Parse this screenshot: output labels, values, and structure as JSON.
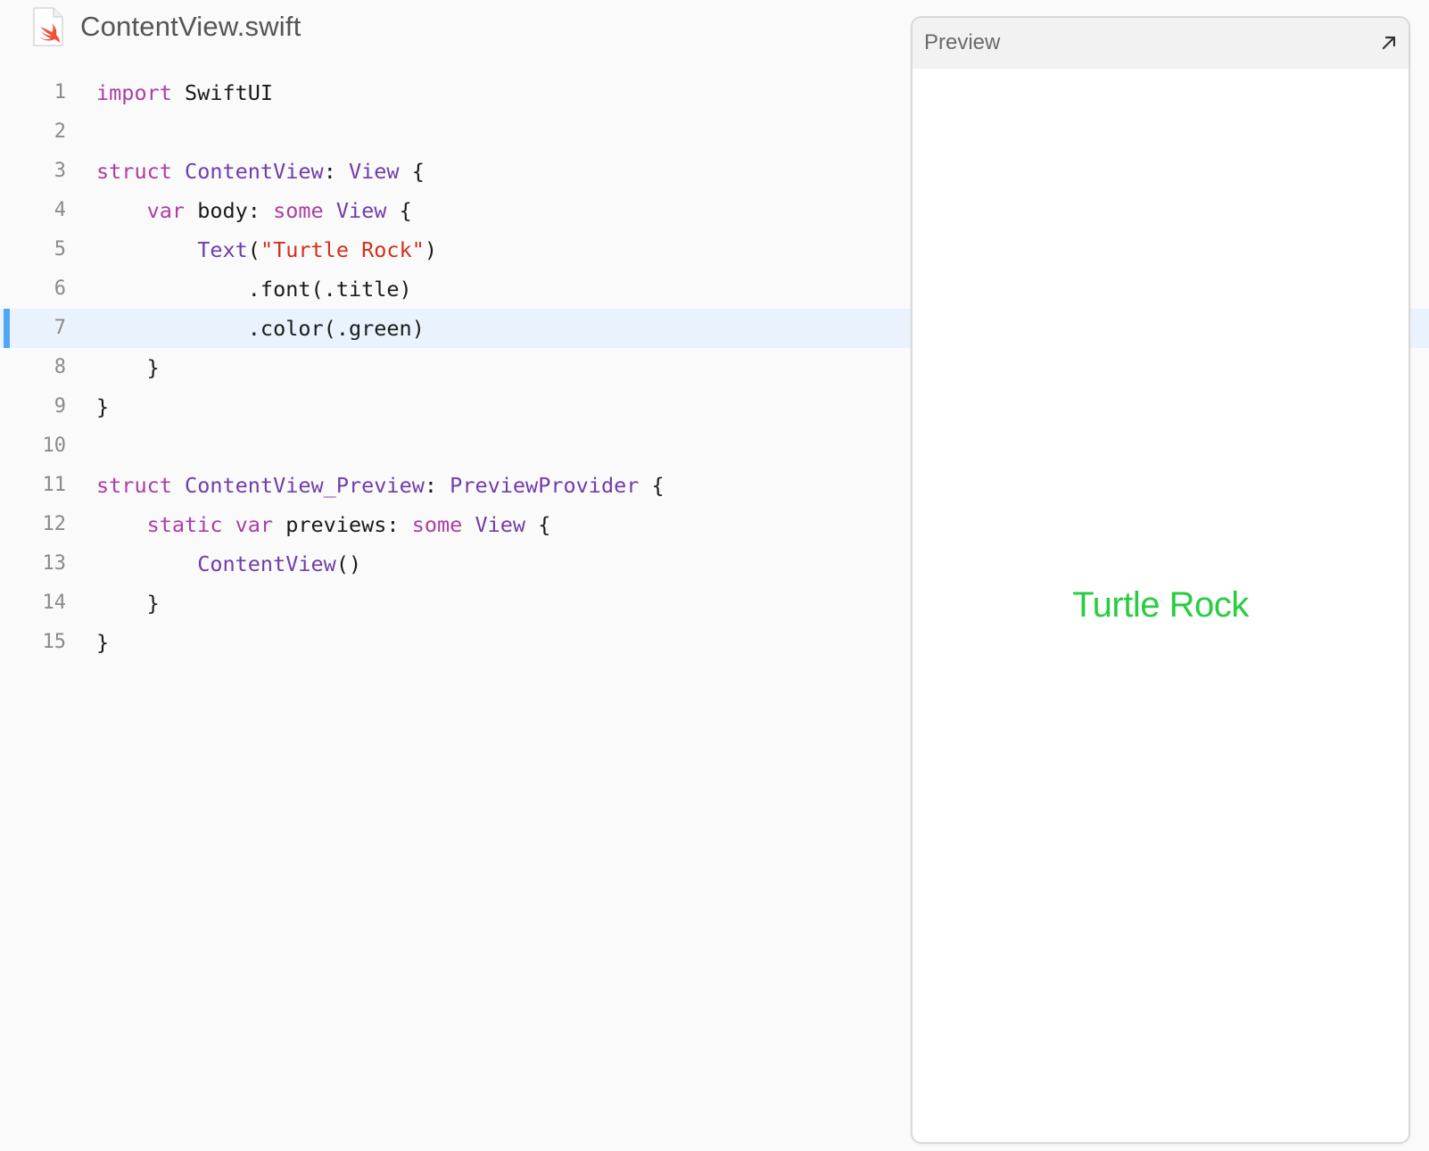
{
  "file": {
    "name": "ContentView.swift",
    "icon": "swift-file-icon"
  },
  "editor": {
    "highlighted_line": 7,
    "lines": [
      {
        "number": "1",
        "tokens": [
          {
            "t": "import",
            "c": "kw"
          },
          {
            "t": " SwiftUI",
            "c": "pl"
          }
        ]
      },
      {
        "number": "2",
        "tokens": []
      },
      {
        "number": "3",
        "tokens": [
          {
            "t": "struct",
            "c": "kw"
          },
          {
            "t": " ",
            "c": "pl"
          },
          {
            "t": "ContentView",
            "c": "ty"
          },
          {
            "t": ": ",
            "c": "pl"
          },
          {
            "t": "View",
            "c": "ty"
          },
          {
            "t": " {",
            "c": "pl"
          }
        ]
      },
      {
        "number": "4",
        "tokens": [
          {
            "t": "    ",
            "c": "pl"
          },
          {
            "t": "var",
            "c": "kw"
          },
          {
            "t": " body: ",
            "c": "pl"
          },
          {
            "t": "some",
            "c": "kw"
          },
          {
            "t": " ",
            "c": "pl"
          },
          {
            "t": "View",
            "c": "ty"
          },
          {
            "t": " {",
            "c": "pl"
          }
        ]
      },
      {
        "number": "5",
        "tokens": [
          {
            "t": "        ",
            "c": "pl"
          },
          {
            "t": "Text",
            "c": "ty"
          },
          {
            "t": "(",
            "c": "pl"
          },
          {
            "t": "\"Turtle Rock\"",
            "c": "str"
          },
          {
            "t": ")",
            "c": "pl"
          }
        ]
      },
      {
        "number": "6",
        "tokens": [
          {
            "t": "            .font(.title)",
            "c": "pl"
          }
        ]
      },
      {
        "number": "7",
        "tokens": [
          {
            "t": "            .color(.green)",
            "c": "pl"
          }
        ]
      },
      {
        "number": "8",
        "tokens": [
          {
            "t": "    }",
            "c": "pl"
          }
        ]
      },
      {
        "number": "9",
        "tokens": [
          {
            "t": "}",
            "c": "pl"
          }
        ]
      },
      {
        "number": "10",
        "tokens": []
      },
      {
        "number": "11",
        "tokens": [
          {
            "t": "struct",
            "c": "kw"
          },
          {
            "t": " ",
            "c": "pl"
          },
          {
            "t": "ContentView_Preview",
            "c": "ty"
          },
          {
            "t": ": ",
            "c": "pl"
          },
          {
            "t": "PreviewProvider",
            "c": "ty"
          },
          {
            "t": " {",
            "c": "pl"
          }
        ]
      },
      {
        "number": "12",
        "tokens": [
          {
            "t": "    ",
            "c": "pl"
          },
          {
            "t": "static",
            "c": "kw"
          },
          {
            "t": " ",
            "c": "pl"
          },
          {
            "t": "var",
            "c": "kw"
          },
          {
            "t": " previews: ",
            "c": "pl"
          },
          {
            "t": "some",
            "c": "kw"
          },
          {
            "t": " ",
            "c": "pl"
          },
          {
            "t": "View",
            "c": "ty"
          },
          {
            "t": " {",
            "c": "pl"
          }
        ]
      },
      {
        "number": "13",
        "tokens": [
          {
            "t": "        ",
            "c": "pl"
          },
          {
            "t": "ContentView",
            "c": "ty"
          },
          {
            "t": "()",
            "c": "pl"
          }
        ]
      },
      {
        "number": "14",
        "tokens": [
          {
            "t": "    }",
            "c": "pl"
          }
        ]
      },
      {
        "number": "15",
        "tokens": [
          {
            "t": "}",
            "c": "pl"
          }
        ]
      }
    ]
  },
  "preview": {
    "title": "Preview",
    "expand_icon": "expand-arrow-icon",
    "content_text": "Turtle Rock",
    "content_color": "#28cd41"
  },
  "colors": {
    "keyword": "#ad3da4",
    "type": "#703daa",
    "string": "#d12f1b",
    "highlight_bg": "#eaf3fd",
    "highlight_bar": "#52a7f5"
  }
}
